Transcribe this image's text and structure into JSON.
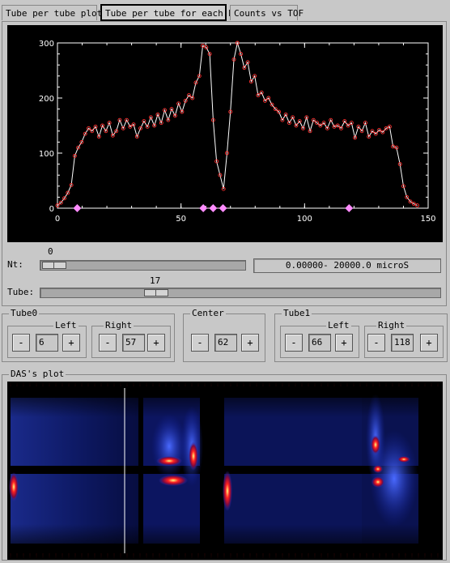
{
  "tabs": [
    {
      "label": "Tube per tube plot",
      "active": false
    },
    {
      "label": "Tube per tube for each Nt",
      "active": true
    },
    {
      "label": "Counts vs TOF",
      "active": false
    }
  ],
  "chart_data": {
    "type": "line",
    "title": "",
    "xlabel": "",
    "ylabel": "",
    "xlim": [
      0,
      150
    ],
    "ylim": [
      0,
      300
    ],
    "x_ticks": [
      "0",
      "50",
      "100",
      "150"
    ],
    "y_ticks": [
      "0",
      "100",
      "200",
      "300"
    ],
    "grid": false,
    "series": [
      {
        "values": [
          5,
          10,
          18,
          28,
          42,
          95,
          110,
          120,
          135,
          145,
          140,
          148,
          130,
          150,
          140,
          155,
          132,
          140,
          160,
          145,
          160,
          148,
          152,
          130,
          145,
          158,
          148,
          165,
          150,
          170,
          155,
          178,
          160,
          180,
          168,
          190,
          175,
          195,
          205,
          200,
          228,
          240,
          295,
          292,
          280,
          160,
          85,
          60,
          35,
          100,
          175,
          270,
          300,
          280,
          255,
          265,
          230,
          240,
          205,
          210,
          195,
          200,
          188,
          180,
          175,
          160,
          170,
          155,
          165,
          150,
          158,
          145,
          165,
          140,
          160,
          155,
          150,
          155,
          145,
          160,
          148,
          150,
          145,
          158,
          150,
          155,
          128,
          148,
          140,
          155,
          130,
          140,
          135,
          142,
          138,
          145,
          148,
          112,
          110,
          80,
          40,
          20,
          12,
          8,
          5
        ],
        "x_start": 0,
        "x_step": 1.4
      }
    ],
    "markers": [
      8,
      59,
      63,
      67,
      118
    ]
  },
  "nt": {
    "label": "Nt:",
    "value": "0",
    "range_text": "0.00000- 20000.0 microS"
  },
  "tube": {
    "label": "Tube:",
    "value": "17"
  },
  "tube0": {
    "title": "Tube0",
    "left": {
      "title": "Left",
      "value": "6"
    },
    "right": {
      "title": "Right",
      "value": "57"
    }
  },
  "center": {
    "title": "Center",
    "value": "62"
  },
  "tube1": {
    "title": "Tube1",
    "left": {
      "title": "Left",
      "value": "66"
    },
    "right": {
      "title": "Right",
      "value": "118"
    }
  },
  "buttons": {
    "minus": "-",
    "plus": "+"
  },
  "das": {
    "title": "DAS's plot"
  },
  "colors": {
    "plot_bg": "#000000",
    "line": "#ffffff",
    "points": "#ff3030",
    "markers": "#ff8cff"
  }
}
